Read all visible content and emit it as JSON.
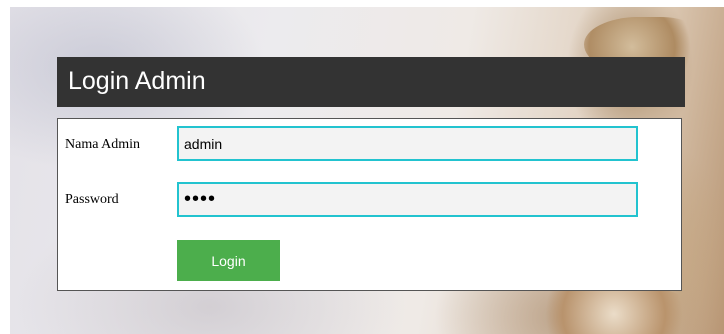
{
  "header": {
    "title": "Login Admin"
  },
  "form": {
    "username_label": "Nama Admin",
    "username_value": "admin",
    "password_label": "Password",
    "password_value": "••••",
    "login_label": "Login"
  },
  "colors": {
    "header_background": "#333333",
    "input_border": "#22c3cf",
    "input_background": "#f3f3f3",
    "button_background": "#4cae4c"
  }
}
